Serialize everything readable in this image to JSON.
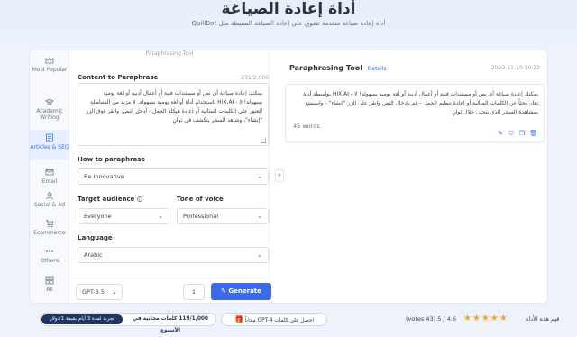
{
  "hero": {
    "title": "أداة إعادة الصياغة",
    "subtitle": "أداة إعادة صياغة متقدمة تتفوق على إعادة الصياغة البسيطة مثل QuillBot"
  },
  "sidebar": {
    "items": [
      {
        "label": "Most Popular",
        "icon": "crown-icon"
      },
      {
        "label": "Academic Writing",
        "icon": "graduation-cap-icon"
      },
      {
        "label": "Articles & SEO",
        "icon": "article-icon"
      },
      {
        "label": "Email",
        "icon": "email-icon"
      },
      {
        "label": "Social & Ad",
        "icon": "social-icon"
      },
      {
        "label": "Ecommerce",
        "icon": "cart-icon"
      },
      {
        "label": "Others",
        "icon": "dots-icon"
      },
      {
        "label": "All",
        "icon": "grid-icon"
      }
    ],
    "active_index": 2
  },
  "form": {
    "scroll_hint": "Paraphrasing Tool",
    "content_label": "Content to Paraphrase",
    "counter": "231/2,000",
    "content_value": "يمكنك إعادة صياغة أي نص أو مستندات فنية أو أعمال أدبية أو لغة يومية بسهولة! لا - HIX.AI باستخدام أداة أو لغة يومية بسهولة. لا مزيد من المماطلة للعثور على الكلمات المثالية أو إعادة هيكلة الجمل - أدخل النص، وانقر فوق الزر \"إنشاء\"، وشاهد السحر يتكشف في ثوانٍ",
    "how_label": "How to paraphrase",
    "how_value": "Be Innovative",
    "audience_label": "Target audience",
    "audience_value": "Everyone",
    "tone_label": "Tone of voice",
    "tone_value": "Professional",
    "language_label": "Language",
    "language_value": "Arabic",
    "model_value": "GPT-3.5",
    "quantity_value": "1",
    "generate_label": "Generate"
  },
  "result": {
    "title": "Paraphrasing Tool",
    "details": "Details",
    "timestamp": "2023-11-10 10:22",
    "text": "يمكنك إعادة صياغة أي نص أو مستندات فنية أو أعمال أدبية أو لغة يومية بسهولة! لا - HIX.AI بواسطة أداة تعان بحثاً عن الكلمات المثالية أو إعادة تنظيم الجمل - قم بإدخال النص وانقر على الزر \"إنشاء\" - واستمتع بمشاهدة السحر الذي يتجلى خلال ثوانٍ",
    "words": "45 words"
  },
  "bottom": {
    "trial_label": "تجربة لمدة 3 أيام بقيمة 1 دولار",
    "free_words": "119/1,000 كلمات مجانية في الأسبوع",
    "gpt4_label": "احصل على كلمات GPT-4 مجاناً",
    "rating_text": "(votes 43) 5 / 4.6",
    "stars": "★★★★★",
    "rating_label": "قيم هذه الأداة"
  },
  "colors": {
    "accent": "#3b6be8",
    "dark_blue": "#1f3564",
    "star": "#f5a623"
  }
}
